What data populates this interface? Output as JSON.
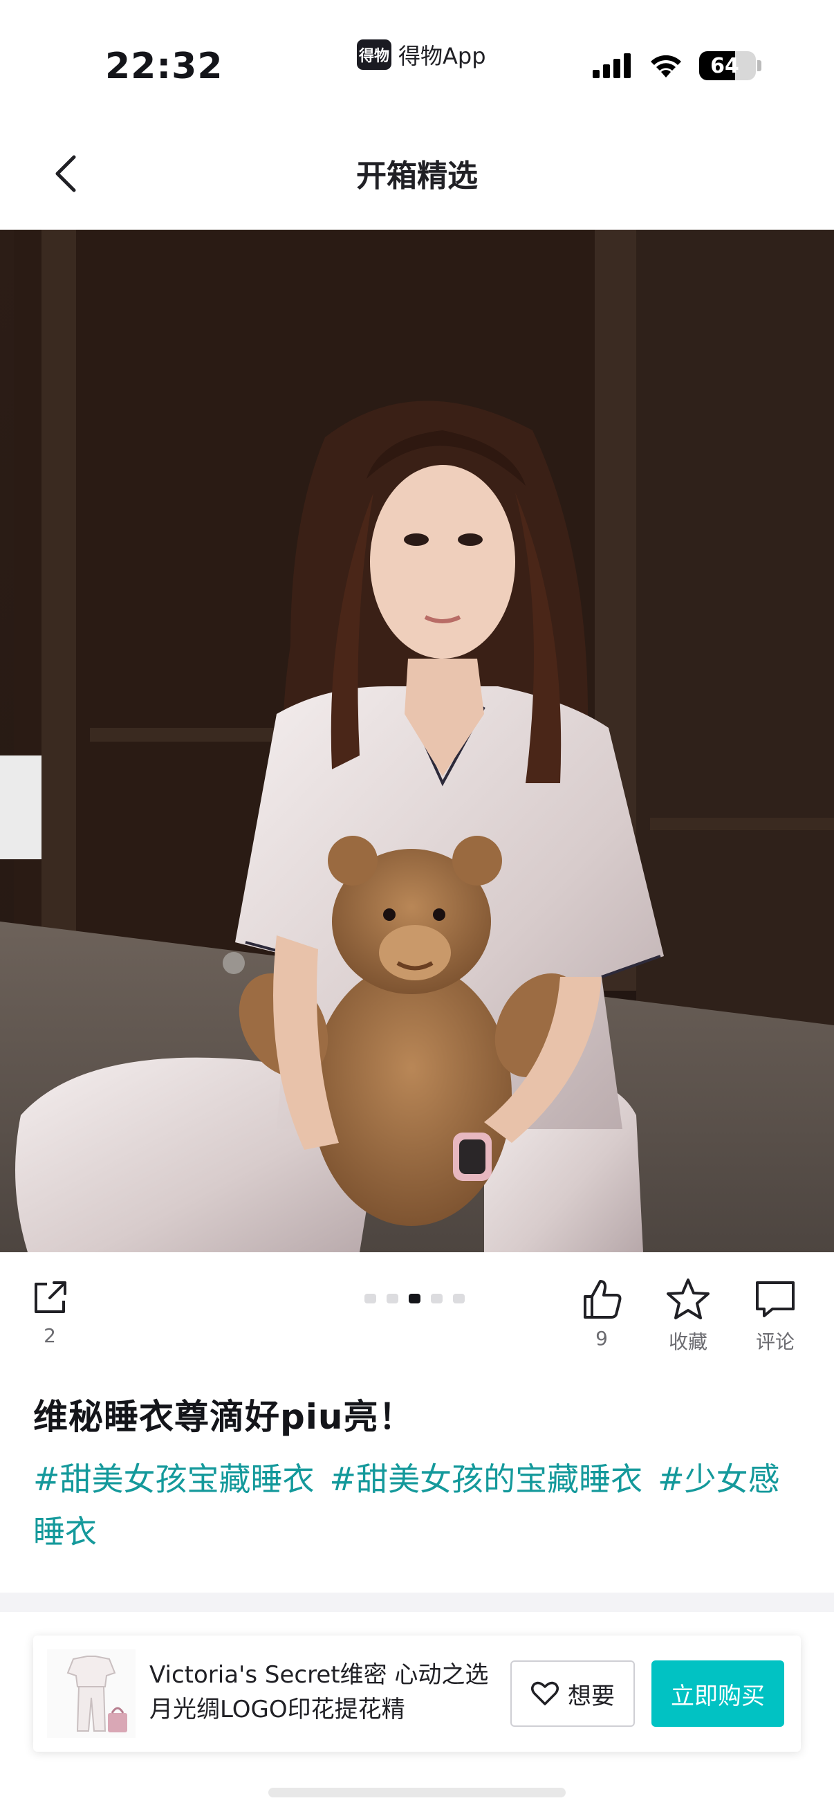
{
  "status": {
    "time": "22:32",
    "app_badge": "得物",
    "app_name": "得物App",
    "battery": "64",
    "battery_level": 0.64
  },
  "nav": {
    "title": "开箱精选"
  },
  "actions": {
    "share_count": "2",
    "like_count": "9",
    "collect_label": "收藏",
    "comment_label": "评论"
  },
  "post": {
    "title": "维秘睡衣尊滴好piu亮！",
    "tags": [
      "#甜美女孩宝藏睡衣",
      "#甜美女孩的宝藏睡衣",
      "#少女感睡衣"
    ]
  },
  "product": {
    "name": "Victoria's Secret维密 心动之选 月光绸LOGO印花提花精",
    "want_label": "想要",
    "buy_label": "立即购买"
  }
}
